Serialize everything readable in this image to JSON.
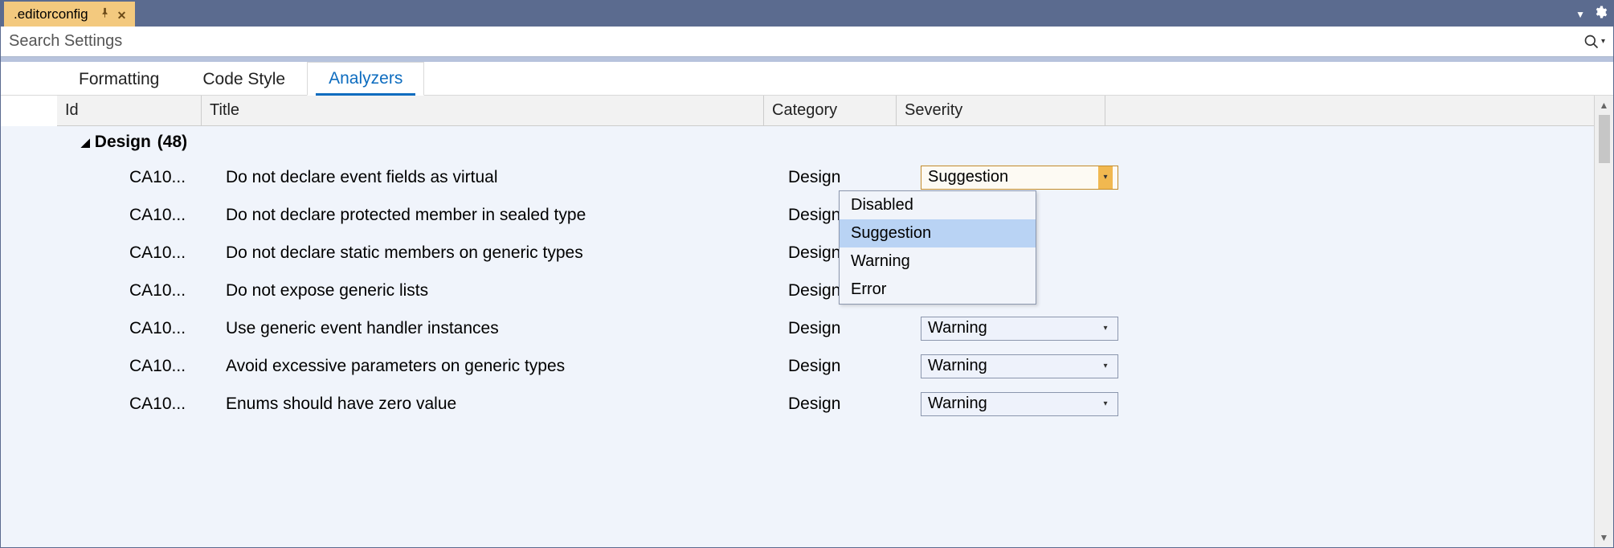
{
  "window": {
    "tab_title": ".editorconfig"
  },
  "search": {
    "placeholder": "Search Settings"
  },
  "nav_tabs": {
    "formatting": "Formatting",
    "code_style": "Code Style",
    "analyzers": "Analyzers"
  },
  "columns": {
    "id": "Id",
    "title": "Title",
    "category": "Category",
    "severity": "Severity"
  },
  "group": {
    "name": "Design",
    "count": "(48)"
  },
  "rules": [
    {
      "id": "CA10...",
      "title": "Do not declare event fields as virtual",
      "category": "Design",
      "severity": "Suggestion",
      "active": true
    },
    {
      "id": "CA10...",
      "title": "Do not declare protected member in sealed type",
      "category": "Design",
      "severity": null
    },
    {
      "id": "CA10...",
      "title": "Do not declare static members on generic types",
      "category": "Design",
      "severity": null
    },
    {
      "id": "CA10...",
      "title": "Do not expose generic lists",
      "category": "Design",
      "severity": null
    },
    {
      "id": "CA10...",
      "title": "Use generic event handler instances",
      "category": "Design",
      "severity": "Warning"
    },
    {
      "id": "CA10...",
      "title": "Avoid excessive parameters on generic types",
      "category": "Design",
      "severity": "Warning"
    },
    {
      "id": "CA10...",
      "title": "Enums should have zero value",
      "category": "Design",
      "severity": "Warning"
    }
  ],
  "dropdown": {
    "options": [
      "Disabled",
      "Suggestion",
      "Warning",
      "Error"
    ],
    "highlighted": "Suggestion"
  }
}
